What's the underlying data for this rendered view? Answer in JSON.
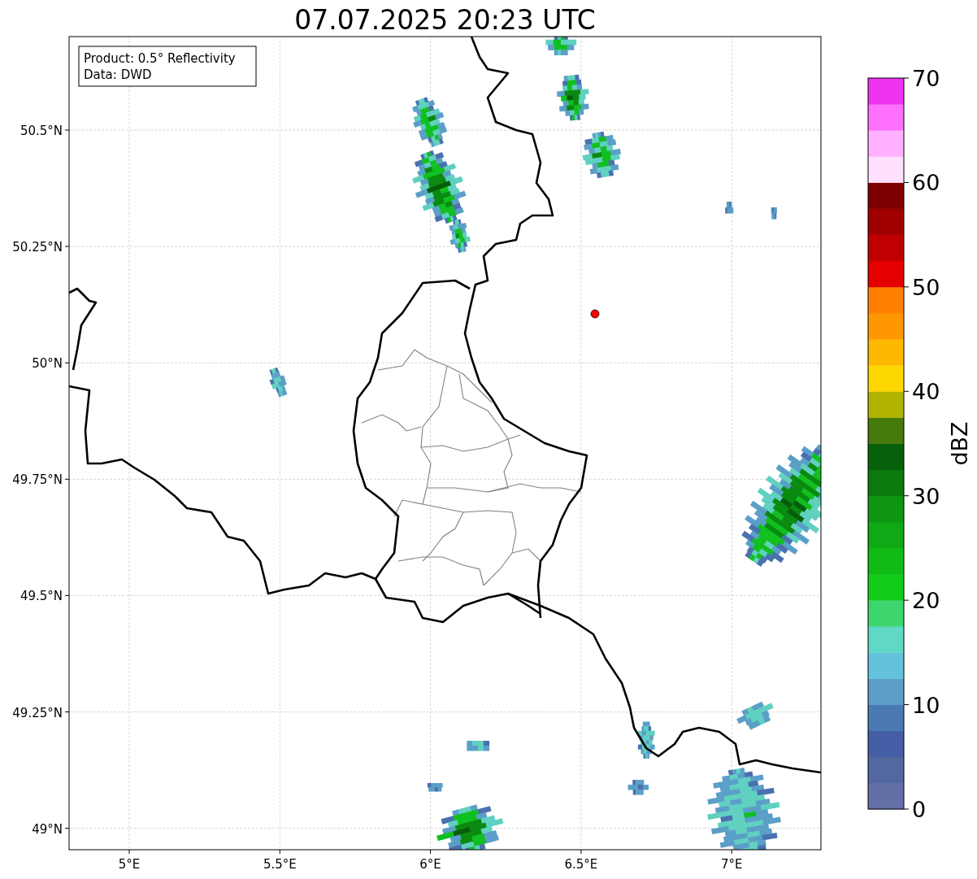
{
  "title": "07.07.2025 20:23 UTC",
  "info_box": {
    "lines": [
      "Product: 0.5° Reflectivity",
      "Data: DWD"
    ]
  },
  "y_ticks": [
    "50.5°N",
    "50.25°N",
    "50°N",
    "49.75°N",
    "49.5°N",
    "49.25°N",
    "49°N"
  ],
  "x_ticks": [
    "5°E",
    "5.5°E",
    "6°E",
    "6.5°E",
    "7°E"
  ],
  "colorbar": {
    "label": "dBZ",
    "ticks": [
      "70",
      "60",
      "50",
      "40",
      "30",
      "20",
      "10",
      "0"
    ],
    "segments": [
      {
        "color": "#6370a8"
      },
      {
        "color": "#5468a0"
      },
      {
        "color": "#445da5"
      },
      {
        "color": "#4b7ab3"
      },
      {
        "color": "#5b9ec8"
      },
      {
        "color": "#64c3dc"
      },
      {
        "color": "#5fd8c6"
      },
      {
        "color": "#3dd66e"
      },
      {
        "color": "#12cc1a"
      },
      {
        "color": "#10bb15"
      },
      {
        "color": "#10a814"
      },
      {
        "color": "#0e9612"
      },
      {
        "color": "#0a7a0e"
      },
      {
        "color": "#06600a"
      },
      {
        "color": "#457a0a"
      },
      {
        "color": "#b0b300"
      },
      {
        "color": "#ffd700"
      },
      {
        "color": "#ffb800"
      },
      {
        "color": "#ff9800"
      },
      {
        "color": "#ff8000"
      },
      {
        "color": "#e50000"
      },
      {
        "color": "#c00000"
      },
      {
        "color": "#a00000"
      },
      {
        "color": "#7d0000"
      },
      {
        "color": "#ffe0ff"
      },
      {
        "color": "#ffb0ff"
      },
      {
        "color": "#ff70ff"
      },
      {
        "color": "#ee33ee"
      }
    ]
  }
}
